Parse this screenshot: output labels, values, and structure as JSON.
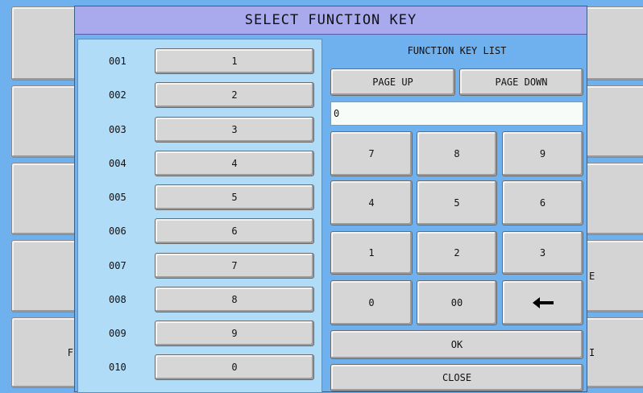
{
  "background_keys": {
    "left": [
      "",
      "",
      "",
      "",
      "F"
    ],
    "right": [
      "",
      "",
      "",
      "E",
      "I"
    ]
  },
  "dialog": {
    "title": "SELECT FUNCTION KEY",
    "list": [
      {
        "num": "001",
        "label": "1"
      },
      {
        "num": "002",
        "label": "2"
      },
      {
        "num": "003",
        "label": "3"
      },
      {
        "num": "004",
        "label": "4"
      },
      {
        "num": "005",
        "label": "5"
      },
      {
        "num": "006",
        "label": "6"
      },
      {
        "num": "007",
        "label": "7"
      },
      {
        "num": "008",
        "label": "8"
      },
      {
        "num": "009",
        "label": "9"
      },
      {
        "num": "010",
        "label": "0"
      }
    ],
    "right": {
      "title": "FUNCTION KEY LIST",
      "page_up": "PAGE UP",
      "page_down": "PAGE DOWN",
      "entry_value": "0",
      "keypad": [
        "7",
        "8",
        "9",
        "4",
        "5",
        "6",
        "1",
        "2",
        "3",
        "0",
        "00"
      ],
      "backspace_icon": "left-arrow-icon",
      "ok": "OK",
      "close": "CLOSE"
    }
  },
  "colors": {
    "background": "#6fb0ee",
    "titlebar": "#a9a9ee",
    "list_panel": "#b0dcf8",
    "button": "#d6d6d6"
  }
}
